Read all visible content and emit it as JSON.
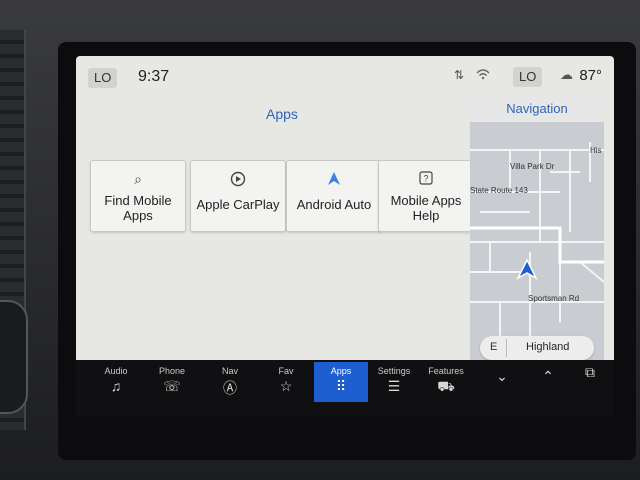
{
  "status": {
    "left_fan": "LO",
    "time": "9:37",
    "right_fan": "LO",
    "temperature": "87°",
    "icons": [
      "signal-icon",
      "wifi-icon",
      "climate-icon"
    ]
  },
  "apps": {
    "title": "Apps",
    "tiles": [
      {
        "label": "Find Mobile Apps",
        "icon": "search-apps-icon"
      },
      {
        "label": "Apple CarPlay",
        "icon": "carplay-icon"
      },
      {
        "label": "Android Auto",
        "icon": "android-auto-icon"
      },
      {
        "label": "Mobile Apps Help",
        "icon": "help-icon"
      }
    ]
  },
  "navigation": {
    "title": "Navigation",
    "labels": {
      "his": "His",
      "villa": "Villa Park Dr",
      "route": "State Route 143",
      "sportsman": "Sportsman Rd"
    },
    "direction": "E",
    "current_road": "Highland"
  },
  "dock": {
    "items": [
      {
        "label": "Audio",
        "icon": "music-note-icon",
        "active": false
      },
      {
        "label": "Phone",
        "icon": "phone-icon",
        "active": false
      },
      {
        "label": "Nav",
        "icon": "nav-icon",
        "active": false
      },
      {
        "label": "Fav",
        "icon": "star-icon",
        "active": false
      },
      {
        "label": "Apps",
        "icon": "apps-grid-icon",
        "active": true
      },
      {
        "label": "Settings",
        "icon": "settings-icon",
        "active": false
      },
      {
        "label": "Features",
        "icon": "truck-icon",
        "active": false
      }
    ],
    "extras": [
      "chevron-down-icon",
      "chevron-up-icon",
      "copy-icon"
    ]
  },
  "colors": {
    "accent": "#2f63b8",
    "active_dock": "#1d5fd0",
    "screen_bg": "#e7e7e4"
  }
}
